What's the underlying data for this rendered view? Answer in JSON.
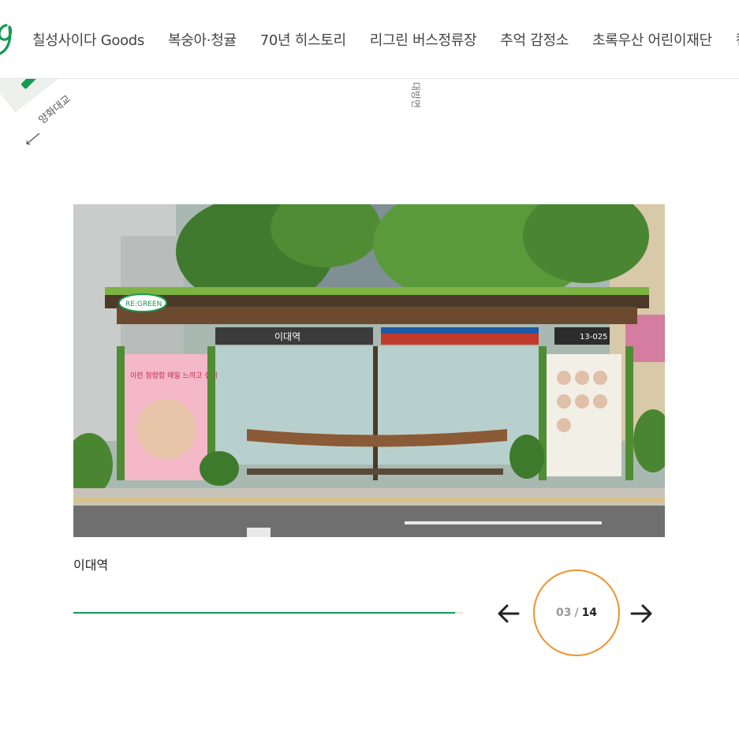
{
  "nav": {
    "logo_icon": "re-green-logo-icon",
    "items": [
      {
        "label": "칠성사이다 Goods"
      },
      {
        "label": "복숭아·청귤"
      },
      {
        "label": "70년 히스토리"
      },
      {
        "label": "리그린 버스정류장"
      },
      {
        "label": "추억 감정소"
      },
      {
        "label": "초록우산 어린이재단"
      },
      {
        "label": "캠"
      }
    ]
  },
  "map": {
    "label_bridge": "양화대교",
    "label_road": "대방면"
  },
  "slide": {
    "caption": "이대역",
    "progress": 0.98,
    "current": "03",
    "separator": "/",
    "total": "14",
    "photo": {
      "brand_sign": "RE:GREEN",
      "station_sign": "이대역",
      "stop_number": "13-025",
      "poster_left_text": "이런 청량함 매일 느끼고 싶어"
    }
  },
  "colors": {
    "accent_green": "#159a52",
    "counter_ring": "#f0912a"
  }
}
